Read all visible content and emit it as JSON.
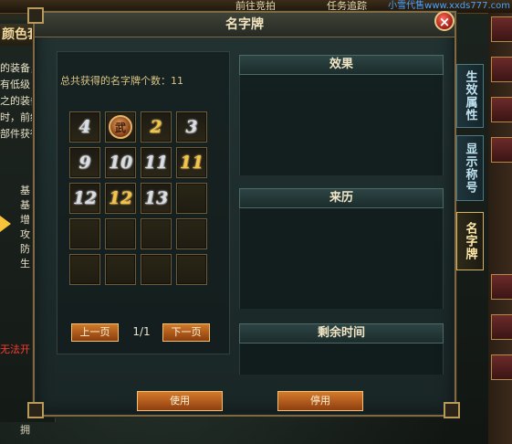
{
  "background": {
    "top_button": "前往竞拍",
    "top_button_2": "任务追踪",
    "watermark": "小雪代售www.xxds777.com",
    "left_title": "颜色套装",
    "left_lines": [
      "的装备，",
      "有低级",
      "之的装备",
      "时，前级",
      "部件获得"
    ],
    "left_stats": [
      "基",
      "基",
      "增",
      "攻",
      "防",
      "生"
    ],
    "red_notice": "无法开",
    "bottom_text": "拥"
  },
  "dialog": {
    "title": "名字牌",
    "close_symbol": "×",
    "count_label": "总共获得的名字牌个数：",
    "count_value": "11",
    "slots": [
      {
        "glyph": "4",
        "style": "silver"
      },
      {
        "glyph": "",
        "style": "medal",
        "medal_text": "武"
      },
      {
        "glyph": "2",
        "style": "gold"
      },
      {
        "glyph": "3",
        "style": "silver"
      },
      {
        "glyph": "9",
        "style": "silver"
      },
      {
        "glyph": "10",
        "style": "silver"
      },
      {
        "glyph": "11",
        "style": "silver"
      },
      {
        "glyph": "11",
        "style": "gold"
      },
      {
        "glyph": "12",
        "style": "silver"
      },
      {
        "glyph": "12",
        "style": "gold"
      },
      {
        "glyph": "13",
        "style": "silver"
      },
      {
        "glyph": "",
        "style": "empty"
      },
      {
        "glyph": "",
        "style": "empty"
      },
      {
        "glyph": "",
        "style": "empty"
      },
      {
        "glyph": "",
        "style": "empty"
      },
      {
        "glyph": "",
        "style": "empty"
      },
      {
        "glyph": "",
        "style": "empty"
      },
      {
        "glyph": "",
        "style": "empty"
      },
      {
        "glyph": "",
        "style": "empty"
      },
      {
        "glyph": "",
        "style": "empty"
      }
    ],
    "prev_page": "上一页",
    "next_page": "下一页",
    "page_indicator": "1/1",
    "effect_header": "效果",
    "origin_header": "来历",
    "remaining_header": "剩余时间",
    "use_button": "使用",
    "disable_button": "停用"
  },
  "side_tabs": [
    {
      "label": "生效属性",
      "active": false
    },
    {
      "label": "显示称号",
      "active": false
    },
    {
      "label": "名字牌",
      "active": true
    }
  ]
}
